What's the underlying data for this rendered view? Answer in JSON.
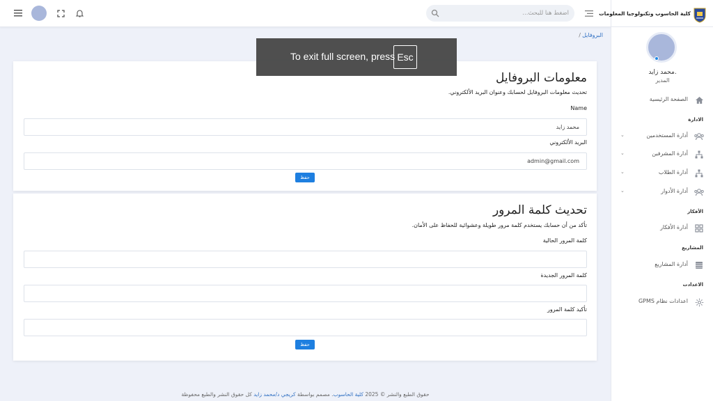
{
  "header": {
    "search_placeholder": "اضغط هنا للبحث..."
  },
  "sidebar": {
    "brand": "كلية الحاسوب وتكنولوجيا المعلومات",
    "user_name": "محمد زايد.",
    "user_role": "المدير",
    "home": "الصفحة الرئيسية",
    "sections": {
      "admin": "الادارة",
      "ideas": "الأفكار",
      "projects": "المشاريع",
      "settings": "الاعدادت"
    },
    "items": {
      "users": "أدارة المستخدمين",
      "supervisors": "أدارة المشرفين",
      "students": "أدارة الطلاب",
      "roles": "أدارة الأدوار",
      "ideas": "أدارة الأفكار",
      "projects": "أدارة المشاريع",
      "gpms": "اعدادات نظام GPMS"
    }
  },
  "breadcrumb": {
    "current": "البروفايل",
    "separator": "/"
  },
  "fullscreen_notice": {
    "text": "To exit full screen, press",
    "key": "Esc"
  },
  "profile_card": {
    "title": "معلومات البروفايل",
    "description": "تحديث معلومات البروفايل لحسابك وعنوان البريد الألكتروني.",
    "name_label": "Name",
    "name_value": "محمد زايد",
    "email_label": "البريد الألكتروني",
    "email_value": "admin@gmail.com",
    "save_label": "حفظ"
  },
  "password_card": {
    "title": "تحديث كلمة المرور",
    "description": "تأكد من أن حسابك يستخدم كلمة مرور طويلة وعشوائية للحفاظ على الأمان.",
    "current_label": "كلمة المرور الحالية",
    "new_label": "كلمة المرور الجديدة",
    "confirm_label": "تأكيد كلمة المرور",
    "save_label": "حفظ"
  },
  "footer": {
    "part1": "حقوق الطبع والنشر © 2025",
    "college": "كلية الحاسوب",
    "part2": ". مصمم بواسطة",
    "designer": "كريجي د/محمد زايد",
    "part3": "كل حقوق النشر والطبع محفوظة"
  },
  "colors": {
    "accent": "#1e7fe0",
    "link": "#2f6fc2",
    "page_bg": "#eef1f9",
    "avatar": "#a9b7db"
  }
}
